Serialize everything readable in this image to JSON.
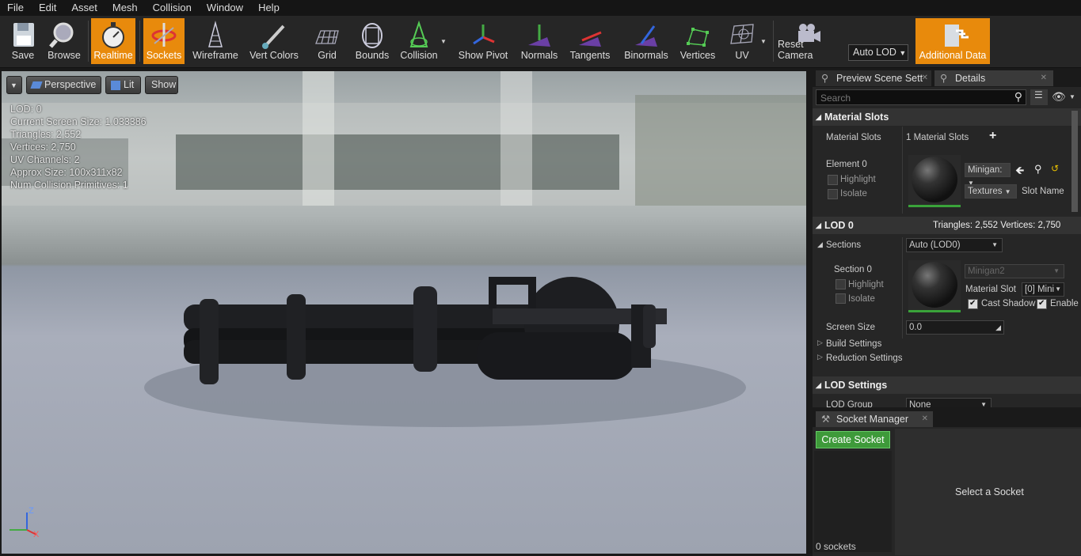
{
  "menu": [
    "File",
    "Edit",
    "Asset",
    "Mesh",
    "Collision",
    "Window",
    "Help"
  ],
  "toolbar": {
    "save": "Save",
    "browse": "Browse",
    "realtime": "Realtime",
    "sockets": "Sockets",
    "wireframe": "Wireframe",
    "vert_colors": "Vert Colors",
    "grid": "Grid",
    "bounds": "Bounds",
    "collision": "Collision",
    "show_pivot": "Show Pivot",
    "normals": "Normals",
    "tangents": "Tangents",
    "binormals": "Binormals",
    "vertices": "Vertices",
    "uv": "UV",
    "reset_camera": "Reset Camera",
    "auto_lod": "Auto LOD",
    "additional_data": "Additional Data"
  },
  "viewport": {
    "perspective": "Perspective",
    "lit": "Lit",
    "show": "Show",
    "stats": [
      "LOD:  0",
      "Current Screen Size:  1.033386",
      "Triangles:  2,552",
      "Vertices:  2,750",
      "UV Channels:  2",
      "Approx Size: 100x311x82",
      "Num Collision Primitives:  1"
    ],
    "axis": {
      "z": "Z",
      "x": "X"
    }
  },
  "tabs": {
    "preview": "Preview Scene Sett",
    "details": "Details",
    "socket_manager": "Socket Manager"
  },
  "details": {
    "search_placeholder": "Search",
    "material_slots_header": "Material Slots",
    "material_slots_label": "Material Slots",
    "material_slots_value": "1 Material Slots",
    "element0": "Element 0",
    "highlight": "Highlight",
    "isolate": "Isolate",
    "material_name": "Minigan:",
    "textures": "Textures",
    "slot_name": "Slot Name",
    "lod0_header": "LOD 0",
    "lod0_stats": "Triangles: 2,552   Vertices: 2,750",
    "sections": "Sections",
    "sections_value": "Auto (LOD0)",
    "section0": "Section 0",
    "section_material": "Minigan2",
    "material_slot_label": "Material Slot",
    "material_slot_value": "[0] Mini",
    "cast_shadow": "Cast Shadow",
    "enable": "Enable",
    "screen_size": "Screen Size",
    "screen_size_value": "0.0",
    "build_settings": "Build Settings",
    "reduction_settings": "Reduction Settings",
    "lod_settings_header": "LOD Settings",
    "lod_group": "LOD Group",
    "lod_group_value": "None"
  },
  "socket": {
    "create": "Create Socket",
    "select": "Select a Socket",
    "count": "0 sockets"
  },
  "colors": {
    "accent": "#e88a0c",
    "green": "#3aa33a"
  }
}
